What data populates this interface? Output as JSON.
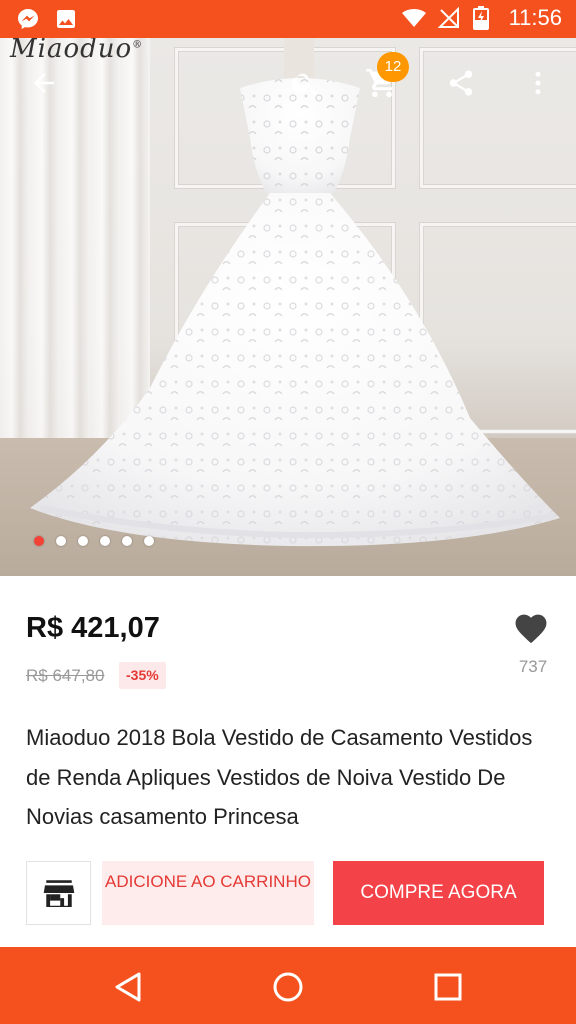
{
  "status_bar": {
    "time": "11:56",
    "left_icons": [
      "messenger-icon",
      "image-icon"
    ],
    "right_icons": [
      "wifi-icon",
      "no-signal-icon",
      "battery-charging-icon"
    ],
    "background_color": "#f4511e"
  },
  "hero": {
    "brand_logo": "Miaoduo",
    "cart_count": "12",
    "carousel_total": 6,
    "carousel_active_index": 0,
    "toolbar_icons": [
      "back-arrow-icon",
      "search-icon",
      "cart-icon",
      "share-icon",
      "more-vert-icon"
    ]
  },
  "product": {
    "price": "R$ 421,07",
    "original_price": "R$ 647,80",
    "discount": "-35%",
    "wishlist_count": "737",
    "title": "Miaoduo 2018 Bola Vestido de Casamento Vestidos de Renda Apliques Vestidos de Noiva Vestido De Novias casamento Princesa"
  },
  "actions": {
    "store_icon": "store-icon",
    "add_to_cart_label": "ADICIONE AO CARRINHO",
    "buy_now_label": "COMPRE AGORA"
  },
  "nav_bar": {
    "icons": [
      "back-triangle-icon",
      "home-circle-icon",
      "recents-square-icon"
    ]
  },
  "colors": {
    "accent_orange": "#f4511e",
    "buy_red": "#f44348",
    "badge_orange": "#ff9800",
    "discount_red": "#e53935"
  }
}
